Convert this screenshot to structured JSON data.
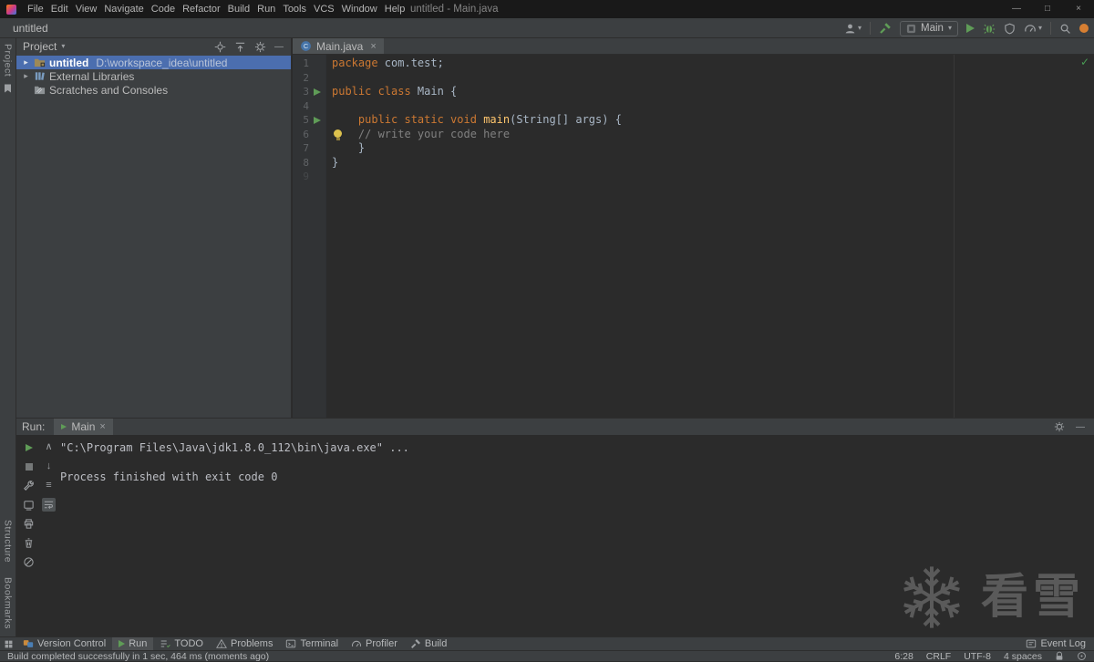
{
  "titlebar": {
    "menus": [
      "File",
      "Edit",
      "View",
      "Navigate",
      "Code",
      "Refactor",
      "Build",
      "Run",
      "Tools",
      "VCS",
      "Window",
      "Help"
    ],
    "title": "untitled - Main.java"
  },
  "navbar": {
    "breadcrumb": "untitled",
    "run_config": "Main"
  },
  "left_stripe": {
    "top_items": [
      "Project"
    ],
    "bottom_items": [
      "Structure",
      "Bookmarks"
    ]
  },
  "project_panel": {
    "title": "Project",
    "tree": [
      {
        "label": "untitled",
        "path": "D:\\workspace_idea\\untitled"
      },
      {
        "label": "External Libraries",
        "path": ""
      },
      {
        "label": "Scratches and Consoles",
        "path": ""
      }
    ]
  },
  "editor": {
    "tab_label": "Main.java",
    "syntax_colors": {
      "keyword": "#cc7832",
      "plain": "#a9b7c6",
      "comment": "#808080",
      "method": "#ffc66d"
    },
    "lines": [
      {
        "num": "1",
        "marker": "",
        "segments": [
          {
            "text": "package ",
            "color": "keyword"
          },
          {
            "text": "com.test;",
            "color": "plain"
          }
        ]
      },
      {
        "num": "2",
        "marker": "",
        "segments": []
      },
      {
        "num": "3",
        "marker": "run",
        "segments": [
          {
            "text": "public class ",
            "color": "keyword"
          },
          {
            "text": "Main {",
            "color": "plain"
          }
        ]
      },
      {
        "num": "4",
        "marker": "",
        "segments": []
      },
      {
        "num": "5",
        "marker": "run",
        "segments": [
          {
            "text": "    ",
            "color": "plain"
          },
          {
            "text": "public static void ",
            "color": "keyword"
          },
          {
            "text": "main",
            "color": "method"
          },
          {
            "text": "(String[] args) {",
            "color": "plain"
          }
        ]
      },
      {
        "num": "6",
        "marker": "bulb",
        "segments": [
          {
            "text": "    ",
            "color": "plain"
          },
          {
            "text": "// write your code here",
            "color": "comment"
          }
        ]
      },
      {
        "num": "7",
        "marker": "",
        "segments": [
          {
            "text": "    }",
            "color": "plain"
          }
        ]
      },
      {
        "num": "8",
        "marker": "",
        "segments": [
          {
            "text": "}",
            "color": "plain"
          }
        ]
      },
      {
        "num": "9",
        "marker": "",
        "dim": true,
        "segments": []
      }
    ]
  },
  "run_panel": {
    "label": "Run:",
    "tab_label": "Main",
    "console_lines": [
      "\"C:\\Program Files\\Java\\jdk1.8.0_112\\bin\\java.exe\" ...",
      "",
      "Process finished with exit code 0"
    ]
  },
  "toolwindow_bar": {
    "left": [
      "Version Control",
      "Run",
      "TODO",
      "Problems",
      "Terminal",
      "Profiler",
      "Build"
    ],
    "right": [
      "Event Log"
    ]
  },
  "statusbar": {
    "message": "Build completed successfully in 1 sec, 464 ms (moments ago)",
    "position": "6:28",
    "line_ending": "CRLF",
    "encoding": "UTF-8",
    "indent": "4 spaces"
  },
  "watermark": {
    "text": "看雪"
  },
  "icons": {
    "caret_down": "▾",
    "tree_collapsed": "▸",
    "close": "×",
    "check": "✓",
    "minimize": "—",
    "maximize": "□",
    "hamburger": "≡",
    "chevron_up": "∧",
    "arrow_down": "↓"
  },
  "colors": {
    "selection": "#4b6eaf",
    "run_green": "#5f9c57",
    "badge_orange": "#d77f32",
    "keyword_orange": "#cc7832"
  }
}
